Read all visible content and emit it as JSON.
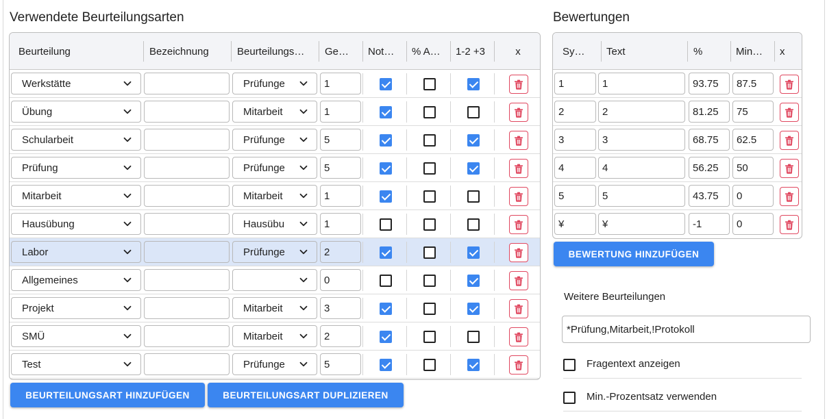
{
  "left": {
    "title": "Verwendete Beurteilungsarten",
    "columns": [
      "Beurteilung",
      "Bezeichnung",
      "Beurteilungs…",
      "Ge…",
      "Not…",
      "% A…",
      "1-2 +3",
      "x"
    ],
    "rows": [
      {
        "beurteilung": "Werkstätte",
        "bezeichnung": "",
        "art": "Prüfunge",
        "gewicht": "1",
        "note": true,
        "prozent": false,
        "plus": true,
        "selected": false
      },
      {
        "beurteilung": "Übung",
        "bezeichnung": "",
        "art": "Mitarbeit",
        "gewicht": "1",
        "note": true,
        "prozent": false,
        "plus": false,
        "selected": false
      },
      {
        "beurteilung": "Schularbeit",
        "bezeichnung": "",
        "art": "Prüfunge",
        "gewicht": "5",
        "note": true,
        "prozent": false,
        "plus": true,
        "selected": false
      },
      {
        "beurteilung": "Prüfung",
        "bezeichnung": "",
        "art": "Prüfunge",
        "gewicht": "5",
        "note": true,
        "prozent": false,
        "plus": true,
        "selected": false
      },
      {
        "beurteilung": "Mitarbeit",
        "bezeichnung": "",
        "art": "Mitarbeit",
        "gewicht": "1",
        "note": true,
        "prozent": false,
        "plus": false,
        "selected": false
      },
      {
        "beurteilung": "Hausübung",
        "bezeichnung": "",
        "art": "Hausübu",
        "gewicht": "1",
        "note": false,
        "prozent": false,
        "plus": false,
        "selected": false
      },
      {
        "beurteilung": "Labor",
        "bezeichnung": "",
        "art": "Prüfunge",
        "gewicht": "2",
        "note": true,
        "prozent": false,
        "plus": true,
        "selected": true
      },
      {
        "beurteilung": "Allgemeines",
        "bezeichnung": "",
        "art": "",
        "gewicht": "0",
        "note": false,
        "prozent": false,
        "plus": true,
        "selected": false
      },
      {
        "beurteilung": "Projekt",
        "bezeichnung": "",
        "art": "Mitarbeit",
        "gewicht": "3",
        "note": true,
        "prozent": false,
        "plus": true,
        "selected": false
      },
      {
        "beurteilung": "SMÜ",
        "bezeichnung": "",
        "art": "Mitarbeit",
        "gewicht": "2",
        "note": true,
        "prozent": false,
        "plus": false,
        "selected": false
      },
      {
        "beurteilung": "Test",
        "bezeichnung": "",
        "art": "Prüfunge",
        "gewicht": "5",
        "note": true,
        "prozent": false,
        "plus": true,
        "selected": false
      }
    ],
    "add_button": "BEURTEILUNGSART HINZUFÜGEN",
    "duplicate_button": "BEURTEILUNGSART DUPLIZIEREN"
  },
  "right": {
    "title": "Bewertungen",
    "columns": [
      "Sy…",
      "Text",
      "%",
      "Min…",
      "x"
    ],
    "rows": [
      {
        "symbol": "1",
        "text": "1",
        "prozent": "93.75",
        "min": "87.5"
      },
      {
        "symbol": "2",
        "text": "2",
        "prozent": "81.25",
        "min": "75"
      },
      {
        "symbol": "3",
        "text": "3",
        "prozent": "68.75",
        "min": "62.5"
      },
      {
        "symbol": "4",
        "text": "4",
        "prozent": "56.25",
        "min": "50"
      },
      {
        "symbol": "5",
        "text": "5",
        "prozent": "43.75",
        "min": "0"
      },
      {
        "symbol": "¥",
        "text": "¥",
        "prozent": "-1",
        "min": "0"
      }
    ],
    "add_button": "BEWERTUNG HINZUFÜGEN",
    "weitere_label": "Weitere Beurteilungen",
    "weitere_value": "*Prüfung,Mitarbeit,!Protokoll",
    "options": [
      {
        "label": "Fragentext anzeigen",
        "checked": false
      },
      {
        "label": "Min.-Prozentsatz verwenden",
        "checked": false
      }
    ]
  },
  "icons": {
    "dropdown": "chevron-down-icon",
    "delete": "trash-icon"
  },
  "colors": {
    "accent": "#3b86f0",
    "danger": "#e0475f",
    "selected_row": "#dbe6f8",
    "header_bg": "#f3f4f7"
  }
}
